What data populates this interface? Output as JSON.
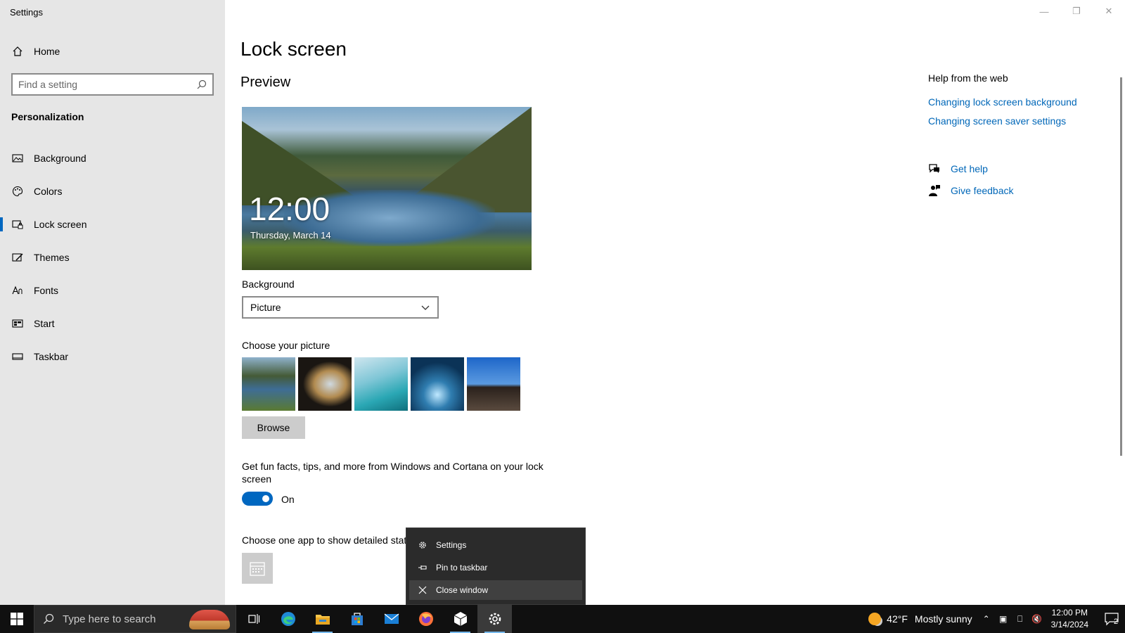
{
  "window": {
    "title": "Settings",
    "controls": [
      "minimize",
      "restore",
      "close"
    ]
  },
  "sidebar": {
    "home_label": "Home",
    "search_placeholder": "Find a setting",
    "section_heading": "Personalization",
    "items": [
      {
        "label": "Background",
        "icon": "picture-icon"
      },
      {
        "label": "Colors",
        "icon": "palette-icon"
      },
      {
        "label": "Lock screen",
        "icon": "lock-screen-icon",
        "active": true
      },
      {
        "label": "Themes",
        "icon": "brush-icon"
      },
      {
        "label": "Fonts",
        "icon": "font-icon"
      },
      {
        "label": "Start",
        "icon": "start-icon"
      },
      {
        "label": "Taskbar",
        "icon": "taskbar-icon"
      }
    ]
  },
  "main": {
    "title": "Lock screen",
    "preview_heading": "Preview",
    "preview_time": "12:00",
    "preview_date": "Thursday, March 14",
    "background_label": "Background",
    "background_value": "Picture",
    "choose_picture_label": "Choose your picture",
    "browse_label": "Browse",
    "tips_text": "Get fun facts, tips, and more from Windows and Cortana on your lock screen",
    "toggle_state": "On",
    "detail_app_label": "Choose one app to show detailed stat"
  },
  "help": {
    "heading": "Help from the web",
    "links": [
      "Changing lock screen background",
      "Changing screen saver settings"
    ],
    "get_help": "Get help",
    "give_feedback": "Give feedback"
  },
  "context_menu": {
    "items": [
      {
        "label": "Settings",
        "icon": "gear-icon"
      },
      {
        "label": "Pin to taskbar",
        "icon": "pin-icon"
      },
      {
        "label": "Close window",
        "icon": "close-icon",
        "hover": true
      }
    ]
  },
  "taskbar": {
    "search_placeholder": "Type here to search",
    "apps": [
      "task-view",
      "edge",
      "file-explorer",
      "store",
      "mail",
      "firefox",
      "package",
      "settings"
    ],
    "weather_temp": "42°F",
    "weather_desc": "Mostly sunny",
    "time": "12:00 PM",
    "date": "3/14/2024",
    "notification_count": "2"
  },
  "colors": {
    "accent": "#0067c0",
    "link": "#0067b8",
    "sidebar_bg": "#e6e6e6",
    "taskbar_bg": "#101010"
  }
}
